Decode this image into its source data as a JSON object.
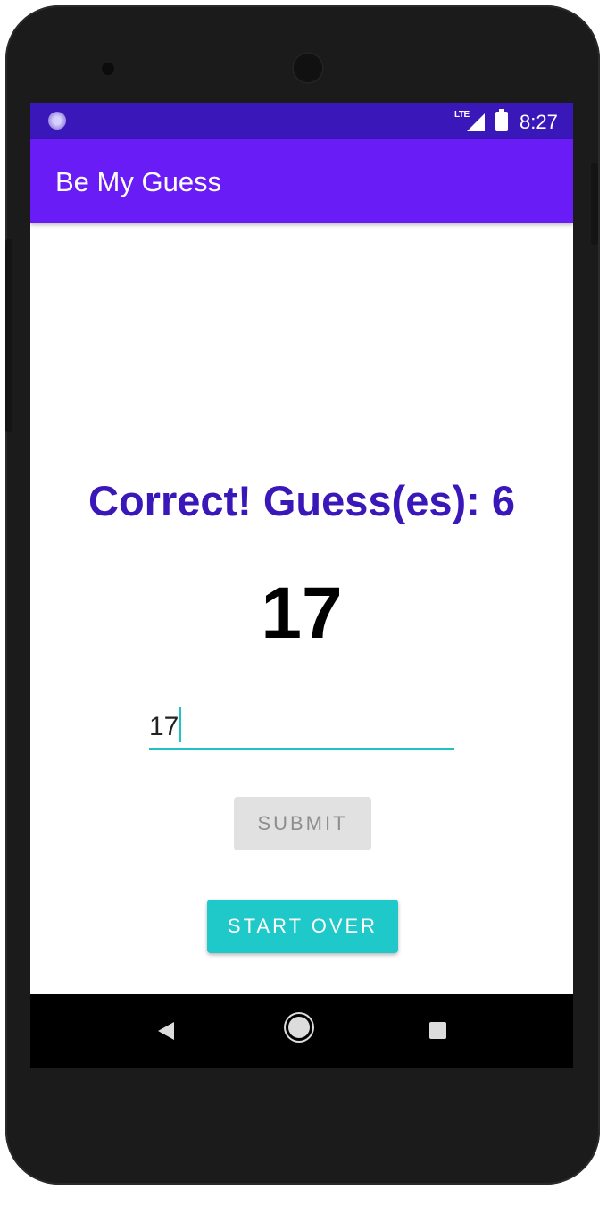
{
  "status_bar": {
    "network_label": "LTE",
    "time": "8:27",
    "icons": [
      "notification-dot-icon",
      "lte-signal-icon",
      "battery-icon"
    ]
  },
  "app_bar": {
    "title": "Be My Guess"
  },
  "main": {
    "result_message": "Correct! Guess(es): 6",
    "target_number": "17",
    "guess_input_value": "17",
    "submit_label": "SUBMIT",
    "submit_enabled": false,
    "start_over_label": "START OVER"
  },
  "nav_bar": {
    "icons": [
      "back-icon",
      "home-icon",
      "recents-icon"
    ]
  },
  "colors": {
    "status_bar": "#3a17b8",
    "app_bar": "#6a1cf6",
    "result_text": "#3a17b8",
    "accent": "#1fc3c6",
    "submit_disabled_bg": "#e1e1e1",
    "start_over_bg": "#1fc8c9"
  }
}
